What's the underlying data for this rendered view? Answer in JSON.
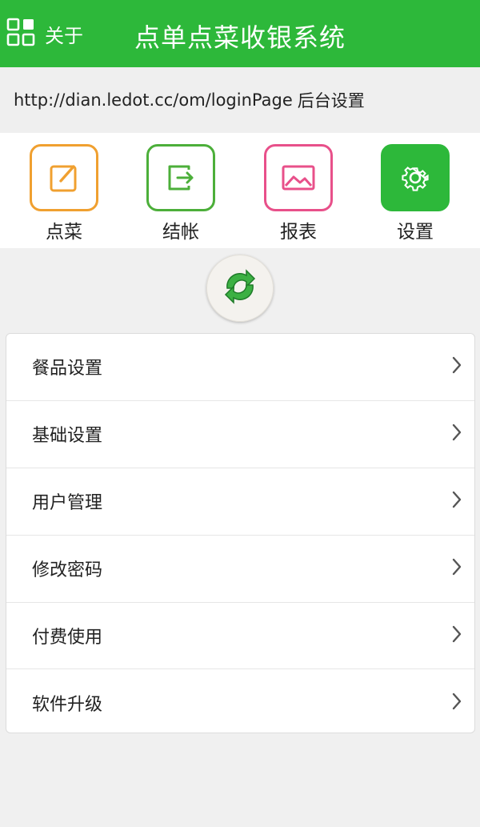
{
  "header": {
    "about_label": "关于",
    "title": "点单点菜收银系统",
    "background": "#2db83a"
  },
  "url_bar": {
    "url": "http://dian.ledot.cc/om/loginPage",
    "suffix": "后台设置"
  },
  "functions": [
    {
      "label": "点菜",
      "icon": "edit-icon",
      "color": "#f0a030"
    },
    {
      "label": "结帐",
      "icon": "exit-icon",
      "color": "#4caf3a"
    },
    {
      "label": "报表",
      "icon": "image-icon",
      "color": "#e8508a"
    },
    {
      "label": "设置",
      "icon": "gear-icon",
      "color": "#2db83a"
    }
  ],
  "refresh": {
    "icon": "refresh-icon"
  },
  "menu": {
    "items": [
      {
        "label": "餐品设置"
      },
      {
        "label": "基础设置"
      },
      {
        "label": "用户管理"
      },
      {
        "label": "修改密码"
      },
      {
        "label": "付费使用"
      },
      {
        "label": "软件升级"
      }
    ]
  }
}
